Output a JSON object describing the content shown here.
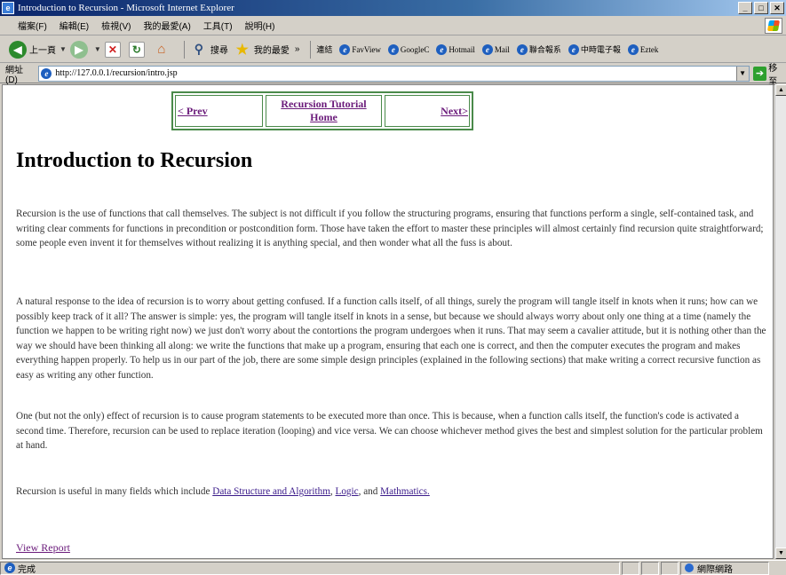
{
  "window": {
    "title": "Introduction to Recursion - Microsoft Internet Explorer",
    "min_glyph": "_",
    "max_glyph": "□",
    "close_glyph": "✕"
  },
  "menu": {
    "items": [
      "檔案(F)",
      "編輯(E)",
      "檢視(V)",
      "我的最愛(A)",
      "工具(T)",
      "說明(H)"
    ]
  },
  "toolbar": {
    "back_label": "上一頁",
    "search_label": "搜尋",
    "favorites_label": "我的最愛",
    "links_label": "連結",
    "links": [
      "FavView",
      "GoogleC",
      "Hotmail",
      "Mail",
      "聯合報系",
      "中時電子報",
      "Eztek"
    ]
  },
  "address": {
    "label": "網址(D)",
    "url": "http://127.0.0.1/recursion/intro.jsp",
    "go_label": "移至"
  },
  "nav": {
    "prev": "< Prev",
    "home_line1": "Recursion Tutorial",
    "home_line2": "Home",
    "next": "Next>"
  },
  "page": {
    "title": "Introduction to Recursion",
    "p1": "Recursion is the use of functions that call themselves. The subject is not difficult if you follow the structuring programs, ensuring that functions perform a single, self-contained task, and writing clear comments for functions in precondition or postcondition form. Those have taken the effort to master these principles will almost certainly find recursion quite straightforward; some people even invent it for themselves without realizing it is anything special, and then wonder what all the fuss is about.",
    "p2": "A natural response to the idea of recursion is to worry about getting confused. If a function calls itself, of all things, surely the program will tangle itself in knots when it runs; how can we possibly keep track of it all? The answer is simple: yes, the program will tangle itself in knots in a sense, but because we should always worry about only one thing at a time (namely the function we happen to be writing right now) we just don't worry about the contortions the program undergoes when it runs. That may seem a cavalier attitude, but it is nothing other than the way we should have been thinking all along: we write the functions that make up a program, ensuring that each one is correct, and then the computer executes the program and makes everything happen properly. To help us in our part of the job, there are some simple design principles (explained in the following sections) that make writing a correct recursive function as easy as writing any other function.",
    "p3": "One (but not the only) effect of recursion is to cause program statements to be executed more than once. This is because, when a function calls itself, the function's code is activated a second time. Therefore, recursion can be used to replace iteration (looping) and vice versa. We can choose whichever method gives the best and simplest solution for the particular problem at hand.",
    "p4_prefix": "Recursion is useful in many fields which include ",
    "link_ds": "Data Structure and Algorithm",
    "sep1": ", ",
    "link_logic": "Logic",
    "sep2": ", and ",
    "link_math": "Mathmatics.",
    "view_report": "View Report"
  },
  "status": {
    "text": "完成",
    "zone": "網際網路"
  }
}
